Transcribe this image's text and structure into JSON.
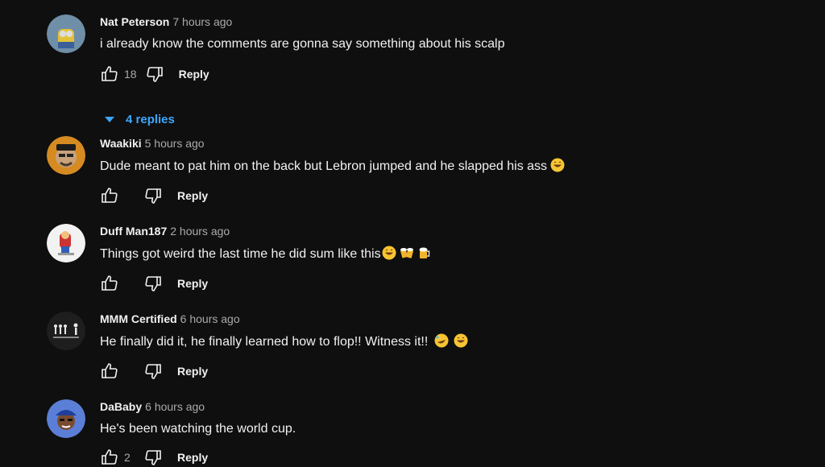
{
  "comments": [
    {
      "author": "Nat Peterson",
      "time": "7 hours ago",
      "text": "i already know the comments are gonna say something about his scalp",
      "likes": "18",
      "reply_label": "Reply",
      "replies_label": "4 replies"
    },
    {
      "author": "Waakiki",
      "time": "5 hours ago",
      "text": "Dude meant to pat him on the back but Lebron jumped and he slapped his ass",
      "likes": "",
      "reply_label": "Reply"
    },
    {
      "author": "Duff Man187",
      "time": "2 hours ago",
      "text": "Things got weird the last time he did sum like this",
      "likes": "",
      "reply_label": "Reply"
    },
    {
      "author": "MMM Certified",
      "time": "6 hours ago",
      "text": "He finally did it, he finally learned how to flop!! Witness it!!",
      "likes": "",
      "reply_label": "Reply"
    },
    {
      "author": "DaBaby",
      "time": "6 hours ago",
      "text": "He's been watching the world cup.",
      "likes": "2",
      "reply_label": "Reply"
    }
  ],
  "icons": {
    "like": "thumbs-up-icon",
    "dislike": "thumbs-down-icon",
    "expand": "caret-down-icon"
  },
  "colors": {
    "background": "#0f0f0f",
    "link": "#3ea6ff",
    "secondary_text": "#aaaaaa"
  }
}
